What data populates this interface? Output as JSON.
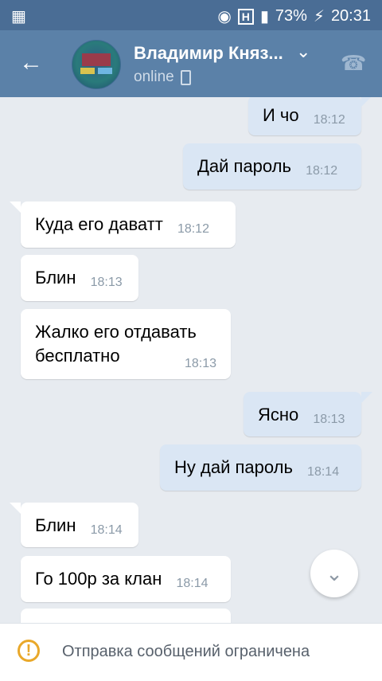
{
  "status_bar": {
    "battery": "73%",
    "time": "20:31",
    "network_badge": "H"
  },
  "header": {
    "name": "Владимир Княз...",
    "status": "online",
    "icons": {
      "back": "arrow-left",
      "dropdown": "chevron-down",
      "call": "phone"
    }
  },
  "messages": [
    {
      "dir": "out",
      "text": "И чо",
      "time": "18:12"
    },
    {
      "dir": "out",
      "text": "Дай пароль",
      "time": "18:12"
    },
    {
      "dir": "in",
      "text": "Куда его даватт",
      "time": "18:12"
    },
    {
      "dir": "in",
      "text": "Блин",
      "time": "18:13"
    },
    {
      "dir": "in",
      "text": "Жалко его отдавать бесплатно",
      "time": "18:13"
    },
    {
      "dir": "out",
      "text": "Ясно",
      "time": "18:13"
    },
    {
      "dir": "out",
      "text": "Ну дай пароль",
      "time": "18:14"
    },
    {
      "dir": "in",
      "text": "Блин",
      "time": "18:14"
    },
    {
      "dir": "in",
      "text": "Го 100р за клан",
      "time": "18:14"
    }
  ],
  "footer": {
    "restriction_text": "Отправка сообщений ограничена"
  },
  "colors": {
    "header": "#5b81a8",
    "statusbar": "#4a6d95",
    "bg": "#e7ebf0",
    "out_bubble": "#dae6f4",
    "warning": "#e9a82a"
  }
}
